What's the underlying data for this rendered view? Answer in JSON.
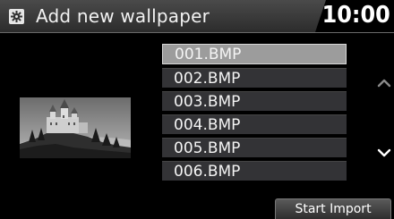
{
  "header": {
    "title": "Add new wallpaper",
    "icon": "settings-gear-icon",
    "clock": "10:00"
  },
  "preview": {
    "icon": "castle-landscape-image"
  },
  "files": [
    {
      "name": "001.BMP",
      "selected": true
    },
    {
      "name": "002.BMP",
      "selected": false
    },
    {
      "name": "003.BMP",
      "selected": false
    },
    {
      "name": "004.BMP",
      "selected": false
    },
    {
      "name": "005.BMP",
      "selected": false
    },
    {
      "name": "006.BMP",
      "selected": false
    }
  ],
  "scroll": {
    "up_icon": "chevron-up-icon",
    "down_icon": "chevron-down-icon"
  },
  "actions": {
    "start_import_label": "Start Import"
  },
  "colors": {
    "header_bg": "#3a3a3a",
    "item_bg": "#333336",
    "item_selected_bg": "#9c9c9c",
    "text": "#ffffff"
  }
}
